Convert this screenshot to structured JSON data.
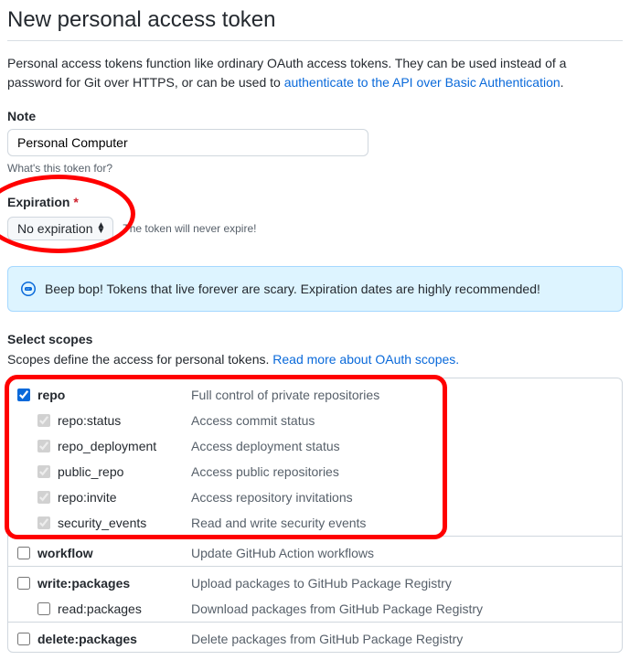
{
  "title": "New personal access token",
  "intro_pre": "Personal access tokens function like ordinary OAuth access tokens. They can be used instead of a password for Git over HTTPS, or can be used to ",
  "intro_link": "authenticate to the API over Basic Authentication",
  "intro_post": ".",
  "note": {
    "label": "Note",
    "value": "Personal Computer",
    "hint": "What's this token for?"
  },
  "expiration": {
    "label": "Expiration",
    "value": "No expiration",
    "message": "The token will never expire!"
  },
  "alert": "Beep bop! Tokens that live forever are scary. Expiration dates are highly recommended!",
  "scopes": {
    "heading": "Select scopes",
    "desc_pre": "Scopes define the access for personal tokens. ",
    "desc_link": "Read more about OAuth scopes."
  },
  "scope_groups": [
    {
      "name": "repo",
      "checked": true,
      "disabled": false,
      "desc": "Full control of private repositories",
      "children": [
        {
          "name": "repo:status",
          "checked": true,
          "disabled": true,
          "desc": "Access commit status"
        },
        {
          "name": "repo_deployment",
          "checked": true,
          "disabled": true,
          "desc": "Access deployment status"
        },
        {
          "name": "public_repo",
          "checked": true,
          "disabled": true,
          "desc": "Access public repositories"
        },
        {
          "name": "repo:invite",
          "checked": true,
          "disabled": true,
          "desc": "Access repository invitations"
        },
        {
          "name": "security_events",
          "checked": true,
          "disabled": true,
          "desc": "Read and write security events"
        }
      ]
    },
    {
      "name": "workflow",
      "checked": false,
      "disabled": false,
      "desc": "Update GitHub Action workflows",
      "children": []
    },
    {
      "name": "write:packages",
      "checked": false,
      "disabled": false,
      "desc": "Upload packages to GitHub Package Registry",
      "children": [
        {
          "name": "read:packages",
          "checked": false,
          "disabled": false,
          "desc": "Download packages from GitHub Package Registry"
        }
      ]
    },
    {
      "name": "delete:packages",
      "checked": false,
      "disabled": false,
      "desc": "Delete packages from GitHub Package Registry",
      "children": []
    }
  ]
}
